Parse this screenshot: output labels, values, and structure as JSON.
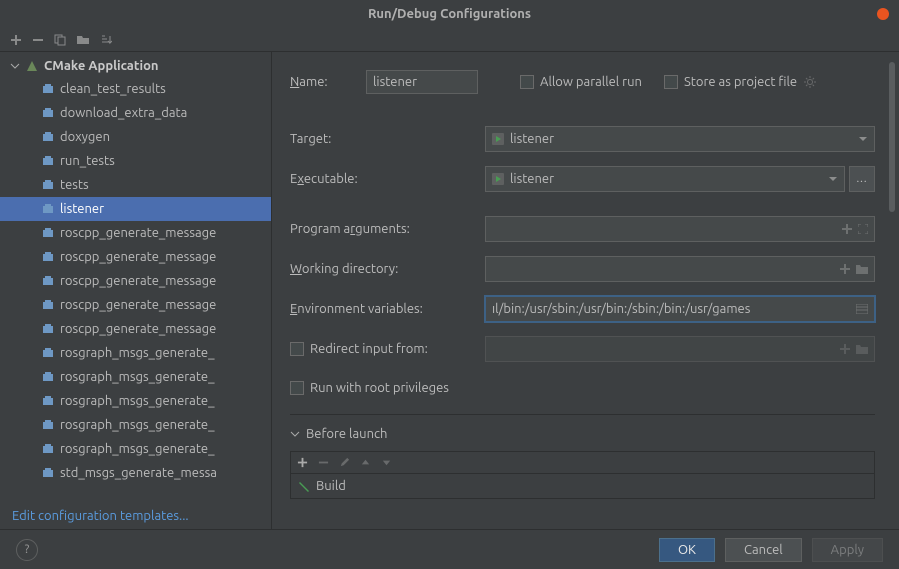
{
  "window": {
    "title": "Run/Debug Configurations"
  },
  "tree": {
    "root": "CMake Application",
    "items": [
      "clean_test_results",
      "download_extra_data",
      "doxygen",
      "run_tests",
      "tests",
      "listener",
      "roscpp_generate_message",
      "roscpp_generate_message",
      "roscpp_generate_message",
      "roscpp_generate_message",
      "roscpp_generate_message",
      "rosgraph_msgs_generate_",
      "rosgraph_msgs_generate_",
      "rosgraph_msgs_generate_",
      "rosgraph_msgs_generate_",
      "rosgraph_msgs_generate_",
      "std_msgs_generate_messa"
    ],
    "selected_index": 5
  },
  "sidebar": {
    "edit_templates": "Edit configuration templates..."
  },
  "form": {
    "name_label": "Name:",
    "name_value": "listener",
    "allow_parallel": "Allow parallel run",
    "store_project": "Store as project file",
    "target_label": "Target:",
    "target_value": "listener",
    "executable_label": "Executable:",
    "executable_value": "listener",
    "program_args_label": "Program arguments:",
    "working_dir_label": "Working directory:",
    "env_vars_label": "Environment variables:",
    "env_vars_value": "ıl/bin:/usr/sbin:/usr/bin:/sbin:/bin:/usr/games",
    "redirect_label": "Redirect input from:",
    "root_priv_label": "Run with root privileges"
  },
  "before_launch": {
    "title": "Before launch",
    "item": "Build"
  },
  "footer": {
    "ok": "OK",
    "cancel": "Cancel",
    "apply": "Apply"
  }
}
